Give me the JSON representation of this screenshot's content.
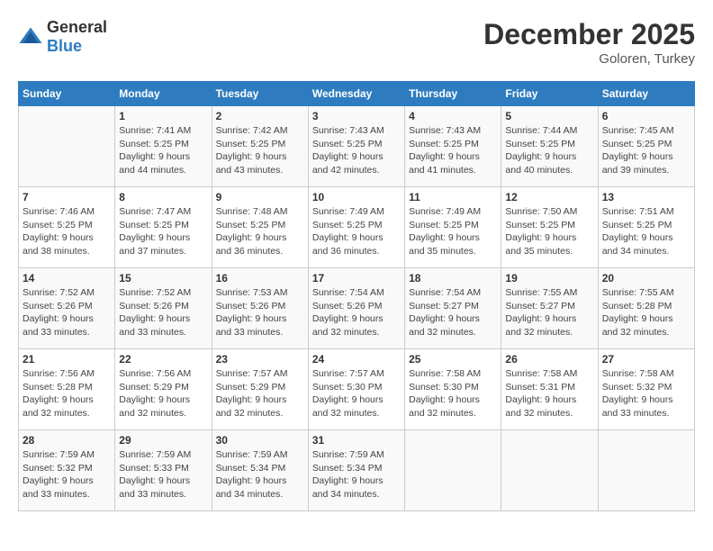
{
  "header": {
    "logo_general": "General",
    "logo_blue": "Blue",
    "month_title": "December 2025",
    "location": "Goloren, Turkey"
  },
  "weekdays": [
    "Sunday",
    "Monday",
    "Tuesday",
    "Wednesday",
    "Thursday",
    "Friday",
    "Saturday"
  ],
  "weeks": [
    [
      {
        "day": "",
        "info": ""
      },
      {
        "day": "1",
        "info": "Sunrise: 7:41 AM\nSunset: 5:25 PM\nDaylight: 9 hours\nand 44 minutes."
      },
      {
        "day": "2",
        "info": "Sunrise: 7:42 AM\nSunset: 5:25 PM\nDaylight: 9 hours\nand 43 minutes."
      },
      {
        "day": "3",
        "info": "Sunrise: 7:43 AM\nSunset: 5:25 PM\nDaylight: 9 hours\nand 42 minutes."
      },
      {
        "day": "4",
        "info": "Sunrise: 7:43 AM\nSunset: 5:25 PM\nDaylight: 9 hours\nand 41 minutes."
      },
      {
        "day": "5",
        "info": "Sunrise: 7:44 AM\nSunset: 5:25 PM\nDaylight: 9 hours\nand 40 minutes."
      },
      {
        "day": "6",
        "info": "Sunrise: 7:45 AM\nSunset: 5:25 PM\nDaylight: 9 hours\nand 39 minutes."
      }
    ],
    [
      {
        "day": "7",
        "info": "Sunrise: 7:46 AM\nSunset: 5:25 PM\nDaylight: 9 hours\nand 38 minutes."
      },
      {
        "day": "8",
        "info": "Sunrise: 7:47 AM\nSunset: 5:25 PM\nDaylight: 9 hours\nand 37 minutes."
      },
      {
        "day": "9",
        "info": "Sunrise: 7:48 AM\nSunset: 5:25 PM\nDaylight: 9 hours\nand 36 minutes."
      },
      {
        "day": "10",
        "info": "Sunrise: 7:49 AM\nSunset: 5:25 PM\nDaylight: 9 hours\nand 36 minutes."
      },
      {
        "day": "11",
        "info": "Sunrise: 7:49 AM\nSunset: 5:25 PM\nDaylight: 9 hours\nand 35 minutes."
      },
      {
        "day": "12",
        "info": "Sunrise: 7:50 AM\nSunset: 5:25 PM\nDaylight: 9 hours\nand 35 minutes."
      },
      {
        "day": "13",
        "info": "Sunrise: 7:51 AM\nSunset: 5:25 PM\nDaylight: 9 hours\nand 34 minutes."
      }
    ],
    [
      {
        "day": "14",
        "info": "Sunrise: 7:52 AM\nSunset: 5:26 PM\nDaylight: 9 hours\nand 33 minutes."
      },
      {
        "day": "15",
        "info": "Sunrise: 7:52 AM\nSunset: 5:26 PM\nDaylight: 9 hours\nand 33 minutes."
      },
      {
        "day": "16",
        "info": "Sunrise: 7:53 AM\nSunset: 5:26 PM\nDaylight: 9 hours\nand 33 minutes."
      },
      {
        "day": "17",
        "info": "Sunrise: 7:54 AM\nSunset: 5:26 PM\nDaylight: 9 hours\nand 32 minutes."
      },
      {
        "day": "18",
        "info": "Sunrise: 7:54 AM\nSunset: 5:27 PM\nDaylight: 9 hours\nand 32 minutes."
      },
      {
        "day": "19",
        "info": "Sunrise: 7:55 AM\nSunset: 5:27 PM\nDaylight: 9 hours\nand 32 minutes."
      },
      {
        "day": "20",
        "info": "Sunrise: 7:55 AM\nSunset: 5:28 PM\nDaylight: 9 hours\nand 32 minutes."
      }
    ],
    [
      {
        "day": "21",
        "info": "Sunrise: 7:56 AM\nSunset: 5:28 PM\nDaylight: 9 hours\nand 32 minutes."
      },
      {
        "day": "22",
        "info": "Sunrise: 7:56 AM\nSunset: 5:29 PM\nDaylight: 9 hours\nand 32 minutes."
      },
      {
        "day": "23",
        "info": "Sunrise: 7:57 AM\nSunset: 5:29 PM\nDaylight: 9 hours\nand 32 minutes."
      },
      {
        "day": "24",
        "info": "Sunrise: 7:57 AM\nSunset: 5:30 PM\nDaylight: 9 hours\nand 32 minutes."
      },
      {
        "day": "25",
        "info": "Sunrise: 7:58 AM\nSunset: 5:30 PM\nDaylight: 9 hours\nand 32 minutes."
      },
      {
        "day": "26",
        "info": "Sunrise: 7:58 AM\nSunset: 5:31 PM\nDaylight: 9 hours\nand 32 minutes."
      },
      {
        "day": "27",
        "info": "Sunrise: 7:58 AM\nSunset: 5:32 PM\nDaylight: 9 hours\nand 33 minutes."
      }
    ],
    [
      {
        "day": "28",
        "info": "Sunrise: 7:59 AM\nSunset: 5:32 PM\nDaylight: 9 hours\nand 33 minutes."
      },
      {
        "day": "29",
        "info": "Sunrise: 7:59 AM\nSunset: 5:33 PM\nDaylight: 9 hours\nand 33 minutes."
      },
      {
        "day": "30",
        "info": "Sunrise: 7:59 AM\nSunset: 5:34 PM\nDaylight: 9 hours\nand 34 minutes."
      },
      {
        "day": "31",
        "info": "Sunrise: 7:59 AM\nSunset: 5:34 PM\nDaylight: 9 hours\nand 34 minutes."
      },
      {
        "day": "",
        "info": ""
      },
      {
        "day": "",
        "info": ""
      },
      {
        "day": "",
        "info": ""
      }
    ]
  ]
}
